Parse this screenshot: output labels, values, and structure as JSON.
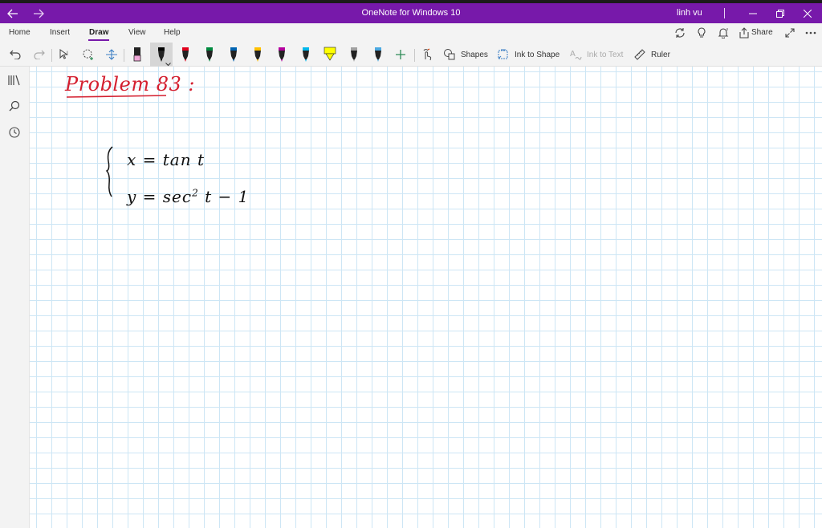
{
  "window": {
    "title": "OneNote for Windows 10",
    "user": "linh vu"
  },
  "tabs": [
    {
      "label": "Home"
    },
    {
      "label": "Insert"
    },
    {
      "label": "Draw"
    },
    {
      "label": "View"
    },
    {
      "label": "Help"
    }
  ],
  "header_actions": {
    "share_label": "Share"
  },
  "toolbar": {
    "shapes_label": "Shapes",
    "ink_to_shape_label": "Ink to Shape",
    "ink_to_text_label": "Ink to Text",
    "ruler_label": "Ruler"
  },
  "pens": [
    {
      "name": "pen-white",
      "color": "#f0a8d8"
    },
    {
      "name": "pen-black",
      "color": "#000000"
    },
    {
      "name": "pen-red",
      "color": "#e0001b"
    },
    {
      "name": "pen-green",
      "color": "#008a3e"
    },
    {
      "name": "pen-blue",
      "color": "#0063b1"
    },
    {
      "name": "pen-yellow",
      "color": "#ffc000"
    },
    {
      "name": "pen-magenta",
      "color": "#b4009e"
    },
    {
      "name": "pen-cyan",
      "color": "#00b7eb"
    },
    {
      "name": "highlighter-yellow",
      "color": "#ffff00"
    },
    {
      "name": "pen-gray",
      "color": "#a0a0a0"
    },
    {
      "name": "pen-light-blue",
      "color": "#4aa8e0"
    }
  ],
  "accent": "#7719aa",
  "page": {
    "heading": "Problem 83 :",
    "eq1": "x = tan t",
    "eq2_left": "y = sec",
    "eq2_exp": "2",
    "eq2_right": "t − 1"
  }
}
